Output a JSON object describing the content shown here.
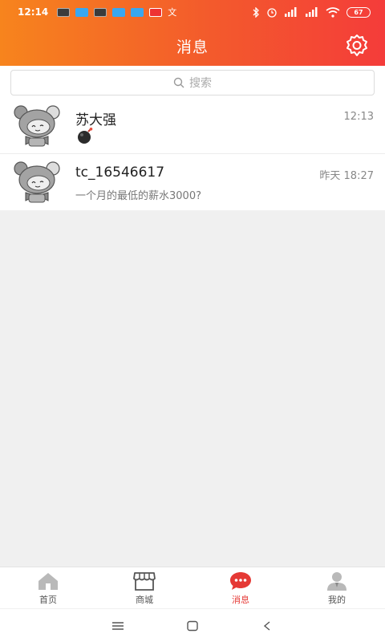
{
  "status": {
    "time": "12:14",
    "battery": "67"
  },
  "header": {
    "title": "消息"
  },
  "search": {
    "placeholder": "搜索"
  },
  "conversations": [
    {
      "name": "苏大强",
      "time": "12:13",
      "preview": "",
      "preview_icon": "bomb-emoji"
    },
    {
      "name": "tc_16546617",
      "time": "昨天 18:27",
      "preview": "一个月的最低的薪水3000?"
    }
  ],
  "tabs": [
    {
      "label": "首页",
      "icon": "home-icon"
    },
    {
      "label": "商城",
      "icon": "store-icon"
    },
    {
      "label": "消息",
      "icon": "message-icon",
      "active": true
    },
    {
      "label": "我的",
      "icon": "user-icon"
    }
  ],
  "colors": {
    "header_start": "#f7841d",
    "header_end": "#f43c3a",
    "active_tab": "#e53935"
  }
}
